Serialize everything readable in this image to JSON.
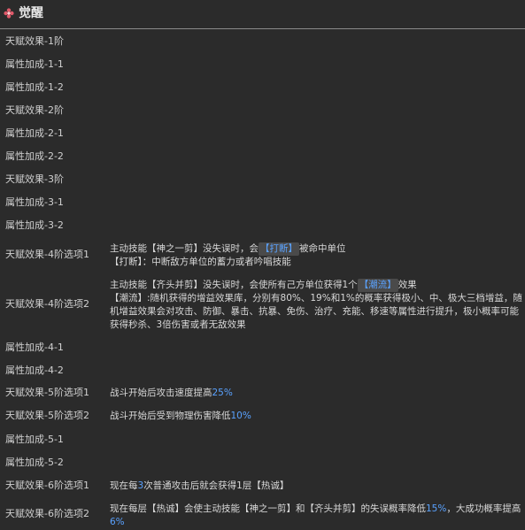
{
  "header": {
    "title": "觉醒",
    "icon": "flower-icon",
    "icon_color": "#e05a6a"
  },
  "rows": [
    {
      "label": "天赋效果-1阶"
    },
    {
      "label": "属性加成-1-1"
    },
    {
      "label": "属性加成-1-2"
    },
    {
      "label": "天赋效果-2阶"
    },
    {
      "label": "属性加成-2-1"
    },
    {
      "label": "属性加成-2-2"
    },
    {
      "label": "天赋效果-3阶"
    },
    {
      "label": "属性加成-3-1"
    },
    {
      "label": "属性加成-3-2"
    },
    {
      "label": "天赋效果-4阶选项1",
      "line1_a": "主动技能【神之一剪】没失误时，会",
      "line1_tag": "【打断】",
      "line1_b": "被命中单位",
      "line2": "【打断】：中断敌方单位的蓄力或者吟唱技能"
    },
    {
      "label": "天赋效果-4阶选项2",
      "line1_a": "主动技能【齐头并剪】没失误时，会使所有己方单位获得1个",
      "line1_tag": "【潮流】",
      "line1_b": "效果",
      "line2": "【潮流】:随机获得的增益效果库，分别有80%、19%和1%的概率获得极小、中、极大三档增益，随机增益效果会对攻击、防御、暴击、抗暴、免伤、治疗、充能、移速等属性进行提升，极小概率可能获得秒杀、3倍伤害或者无敌效果"
    },
    {
      "label": "属性加成-4-1"
    },
    {
      "label": "属性加成-4-2"
    },
    {
      "label": "天赋效果-5阶选项1",
      "text_a": "战斗开始后攻击速度提高",
      "text_hl": "25%"
    },
    {
      "label": "天赋效果-5阶选项2",
      "text_a": "战斗开始后受到物理伤害降低",
      "text_hl": "10%"
    },
    {
      "label": "属性加成-5-1"
    },
    {
      "label": "属性加成-5-2"
    },
    {
      "label": "天赋效果-6阶选项1",
      "text_a": "现在每",
      "text_hl": "3",
      "text_b": "次普通攻击后就会获得1层【热诚】"
    },
    {
      "label": "天赋效果-6阶选项2",
      "text_a": "现在每层【热诚】会使主动技能【神之一剪】和【齐头并剪】的失误概率降低",
      "text_hl": "15%",
      "text_b": "，大成功概率提高",
      "text_hl2": "6%"
    }
  ],
  "colors": {
    "background": "#2b2b2b",
    "highlight": "#5aa2ff"
  }
}
